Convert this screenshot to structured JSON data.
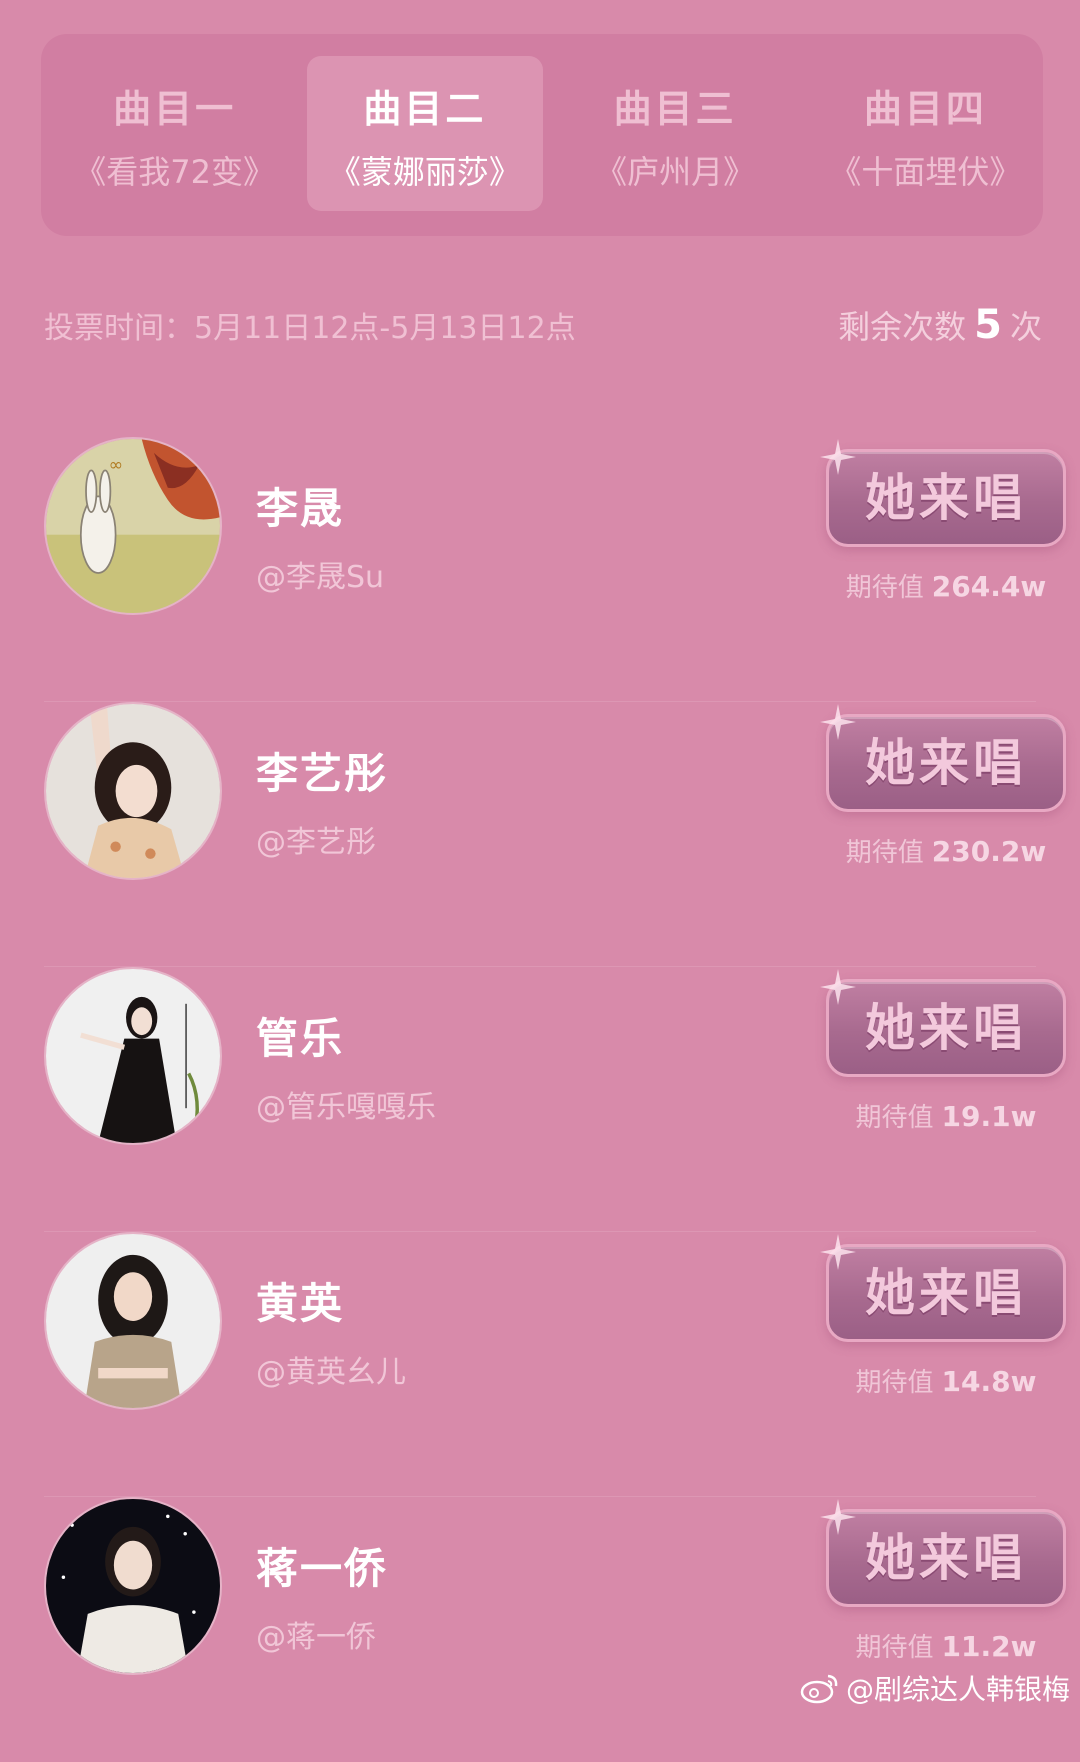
{
  "tabs": [
    {
      "title": "曲目一",
      "song": "《看我72变》",
      "active": false
    },
    {
      "title": "曲目二",
      "song": "《蒙娜丽莎》",
      "active": true
    },
    {
      "title": "曲目三",
      "song": "《庐州月》",
      "active": false
    },
    {
      "title": "曲目四",
      "song": "《十面埋伏》",
      "active": false
    }
  ],
  "vote": {
    "time_label": "投票时间：5月11日12点-5月13日12点",
    "remaining_label": "剩余次数",
    "remaining_count": "5",
    "remaining_unit": "次"
  },
  "button_label": "她来唱",
  "expect_label": "期待值",
  "candidates": [
    {
      "name": "李晟",
      "handle": "@李晟Su",
      "expect": "264.4w"
    },
    {
      "name": "李艺彤",
      "handle": "@李艺彤",
      "expect": "230.2w"
    },
    {
      "name": "管乐",
      "handle": "@管乐嘎嘎乐",
      "expect": "19.1w"
    },
    {
      "name": "黄英",
      "handle": "@黄英幺儿",
      "expect": "14.8w"
    },
    {
      "name": "蒋一侨",
      "handle": "@蒋一侨",
      "expect": "11.2w"
    }
  ],
  "watermark": "@剧综达人韩银梅",
  "colors": {
    "background": "#d88aaa",
    "tab_bg": "#d17ea2",
    "button": "#a86a8f"
  }
}
